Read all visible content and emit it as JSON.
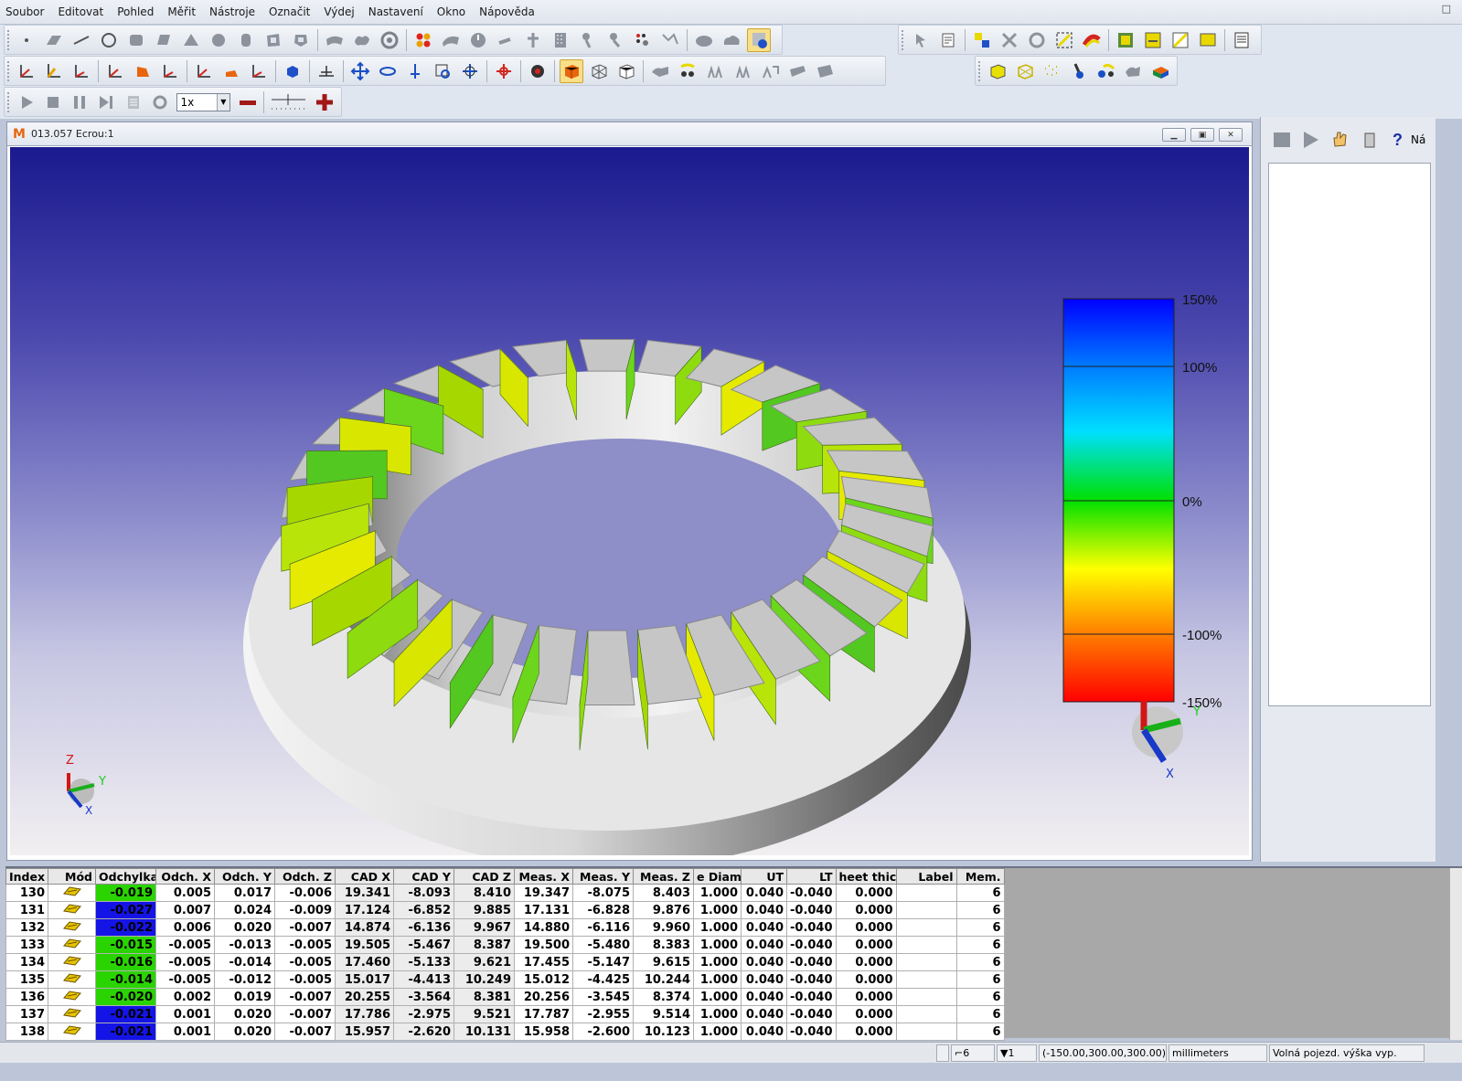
{
  "menu": [
    "Soubor",
    "Editovat",
    "Pohled",
    "Měřit",
    "Nástroje",
    "Označit",
    "Výdej",
    "Nastavení",
    "Okno",
    "Nápověda"
  ],
  "toolbar": {
    "speed": "1x"
  },
  "window": {
    "logo": "M",
    "title": "013.057 Ecrou:1"
  },
  "colors": {
    "accent": "#e8650d",
    "green": "#2ad400",
    "blue": "#1414e6"
  },
  "color_scale": {
    "labels": [
      "150%",
      "100%",
      "0%",
      "-100%",
      "-150%"
    ],
    "stops": [
      "#0000ff",
      "#00c8ff",
      "#00e020",
      "#ffff00",
      "#ff8000",
      "#ff0000"
    ]
  },
  "axes": {
    "z": "Z",
    "y": "Y",
    "x": "X"
  },
  "right_panel": {
    "button_label": "Ná"
  },
  "table": {
    "headers": [
      "Index",
      "Mód",
      "Odchylka",
      "Odch. X",
      "Odch. Y",
      "Odch. Z",
      "CAD X",
      "CAD Y",
      "CAD Z",
      "Meas. X",
      "Meas. Y",
      "Meas. Z",
      "e Diam.",
      "UT",
      "LT",
      "heet thick.",
      "Label",
      "Mem."
    ],
    "rows": [
      {
        "index": "130",
        "mode": "probe-icon",
        "dev": "-0.019",
        "dev_color": "green",
        "dx": "0.005",
        "dy": "0.017",
        "dz": "-0.006",
        "cx": "19.341",
        "cy": "-8.093",
        "cz": "8.410",
        "mx": "19.347",
        "my": "-8.075",
        "mz": "8.403",
        "diam": "1.000",
        "ut": "0.040",
        "lt": "-0.040",
        "sheet": "0.000",
        "label": "",
        "mem": "6"
      },
      {
        "index": "131",
        "mode": "probe-icon",
        "dev": "-0.027",
        "dev_color": "blue",
        "dx": "0.007",
        "dy": "0.024",
        "dz": "-0.009",
        "cx": "17.124",
        "cy": "-6.852",
        "cz": "9.885",
        "mx": "17.131",
        "my": "-6.828",
        "mz": "9.876",
        "diam": "1.000",
        "ut": "0.040",
        "lt": "-0.040",
        "sheet": "0.000",
        "label": "",
        "mem": "6"
      },
      {
        "index": "132",
        "mode": "probe-icon",
        "dev": "-0.022",
        "dev_color": "blue",
        "dx": "0.006",
        "dy": "0.020",
        "dz": "-0.007",
        "cx": "14.874",
        "cy": "-6.136",
        "cz": "9.967",
        "mx": "14.880",
        "my": "-6.116",
        "mz": "9.960",
        "diam": "1.000",
        "ut": "0.040",
        "lt": "-0.040",
        "sheet": "0.000",
        "label": "",
        "mem": "6"
      },
      {
        "index": "133",
        "mode": "probe-icon",
        "dev": "-0.015",
        "dev_color": "green",
        "dx": "-0.005",
        "dy": "-0.013",
        "dz": "-0.005",
        "cx": "19.505",
        "cy": "-5.467",
        "cz": "8.387",
        "mx": "19.500",
        "my": "-5.480",
        "mz": "8.383",
        "diam": "1.000",
        "ut": "0.040",
        "lt": "-0.040",
        "sheet": "0.000",
        "label": "",
        "mem": "6"
      },
      {
        "index": "134",
        "mode": "probe-icon",
        "dev": "-0.016",
        "dev_color": "green",
        "dx": "-0.005",
        "dy": "-0.014",
        "dz": "-0.005",
        "cx": "17.460",
        "cy": "-5.133",
        "cz": "9.621",
        "mx": "17.455",
        "my": "-5.147",
        "mz": "9.615",
        "diam": "1.000",
        "ut": "0.040",
        "lt": "-0.040",
        "sheet": "0.000",
        "label": "",
        "mem": "6"
      },
      {
        "index": "135",
        "mode": "probe-icon",
        "dev": "-0.014",
        "dev_color": "green",
        "dx": "-0.005",
        "dy": "-0.012",
        "dz": "-0.005",
        "cx": "15.017",
        "cy": "-4.413",
        "cz": "10.249",
        "mx": "15.012",
        "my": "-4.425",
        "mz": "10.244",
        "diam": "1.000",
        "ut": "0.040",
        "lt": "-0.040",
        "sheet": "0.000",
        "label": "",
        "mem": "6"
      },
      {
        "index": "136",
        "mode": "probe-icon",
        "dev": "-0.020",
        "dev_color": "green",
        "dx": "0.002",
        "dy": "0.019",
        "dz": "-0.007",
        "cx": "20.255",
        "cy": "-3.564",
        "cz": "8.381",
        "mx": "20.256",
        "my": "-3.545",
        "mz": "8.374",
        "diam": "1.000",
        "ut": "0.040",
        "lt": "-0.040",
        "sheet": "0.000",
        "label": "",
        "mem": "6"
      },
      {
        "index": "137",
        "mode": "probe-icon",
        "dev": "-0.021",
        "dev_color": "blue",
        "dx": "0.001",
        "dy": "0.020",
        "dz": "-0.007",
        "cx": "17.786",
        "cy": "-2.975",
        "cz": "9.521",
        "mx": "17.787",
        "my": "-2.955",
        "mz": "9.514",
        "diam": "1.000",
        "ut": "0.040",
        "lt": "-0.040",
        "sheet": "0.000",
        "label": "",
        "mem": "6"
      },
      {
        "index": "138",
        "mode": "probe-icon",
        "dev": "-0.021",
        "dev_color": "blue",
        "dx": "0.001",
        "dy": "0.020",
        "dz": "-0.007",
        "cx": "15.957",
        "cy": "-2.620",
        "cz": "10.131",
        "mx": "15.958",
        "my": "-2.600",
        "mz": "10.123",
        "diam": "1.000",
        "ut": "0.040",
        "lt": "-0.040",
        "sheet": "0.000",
        "label": "",
        "mem": "6"
      }
    ]
  },
  "status": {
    "probe_count": "6",
    "tip_count": "1",
    "coords": "(-150.00,300.00,300.00)",
    "units": "millimeters",
    "mode": "Volná pojezd. výška vyp."
  }
}
